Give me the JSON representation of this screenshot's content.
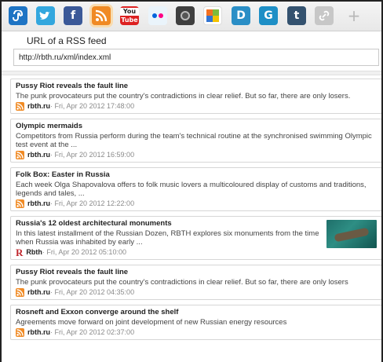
{
  "toolbar": {
    "icons": [
      {
        "name": "stumbleupon-icon",
        "glyph": "S",
        "color": "#1e74c4"
      },
      {
        "name": "twitter-icon",
        "glyph": "t",
        "color": "#33a7de"
      },
      {
        "name": "facebook-icon",
        "glyph": "f",
        "color": "#3b5998"
      },
      {
        "name": "rss-icon",
        "glyph": "",
        "color": "#f08a24"
      },
      {
        "name": "youtube-icon",
        "glyph": "You",
        "color": "#d22"
      },
      {
        "name": "flickr-icon",
        "glyph": "••",
        "color": "#eaf4fb"
      },
      {
        "name": "instagram-icon",
        "glyph": "",
        "color": "#3f3f3f"
      },
      {
        "name": "delicious-icon",
        "glyph": "",
        "color": "#ffffff"
      },
      {
        "name": "digg-icon",
        "glyph": "D",
        "color": "#2a8ec6"
      },
      {
        "name": "google-icon",
        "glyph": "G",
        "color": "#1e8fc6"
      },
      {
        "name": "tumblr-icon",
        "glyph": "t",
        "color": "#34526f"
      },
      {
        "name": "link-icon",
        "glyph": "",
        "color": "#c7c7c7"
      },
      {
        "name": "add-icon",
        "glyph": "+",
        "color": "transparent"
      }
    ]
  },
  "url_panel": {
    "label": "URL of a RSS feed",
    "value": "http://rbth.ru/xml/index.xml"
  },
  "feed": {
    "items": [
      {
        "title": "Pussy Riot reveals the fault line",
        "description": "The punk provocateurs put the country's contradictions in clear relief. But so far, there are only losers.",
        "source": "rbth.ru",
        "date": " · Fri, Apr 20 2012 17:48:00",
        "source_icon": "rss"
      },
      {
        "title": "Olympic mermaids",
        "description": "Competitors from Russia perform during the team's technical routine at the synchronised swimming Olympic test event at the ...",
        "source": "rbth.ru",
        "date": " · Fri, Apr 20 2012 16:59:00",
        "source_icon": "rss"
      },
      {
        "title": "Folk Box: Easter in Russia",
        "description": "Each week Olga Shapovalova offers to folk music lovers a multicoloured display of customs and traditions, legends and tales, ...",
        "source": "rbth.ru",
        "date": " · Fri, Apr 20 2012 12:22:00",
        "source_icon": "rss"
      },
      {
        "title": "Russia's 12 oldest architectural monuments",
        "description": "In this latest installment of the Russian Dozen, RBTH explores six monuments from the time when Russia was inhabited by early ...",
        "source": "Rbth",
        "date": " · Fri, Apr 20 2012 05:10:00",
        "source_icon": "rbth",
        "has_thumb": true
      },
      {
        "title": "Pussy Riot reveals the fault line",
        "description": "The punk provocateurs put the country's contradictions in clear relief. But so far, there are only losers",
        "source": "rbth.ru",
        "date": " · Fri, Apr 20 2012 04:35:00",
        "source_icon": "rss"
      },
      {
        "title": "Rosneft and Exxon converge around the shelf",
        "description": "Agreements move forward on joint development of new Russian energy resources",
        "source": "rbth.ru",
        "date": " · Fri, Apr 20 2012 02:37:00",
        "source_icon": "rss"
      }
    ]
  }
}
